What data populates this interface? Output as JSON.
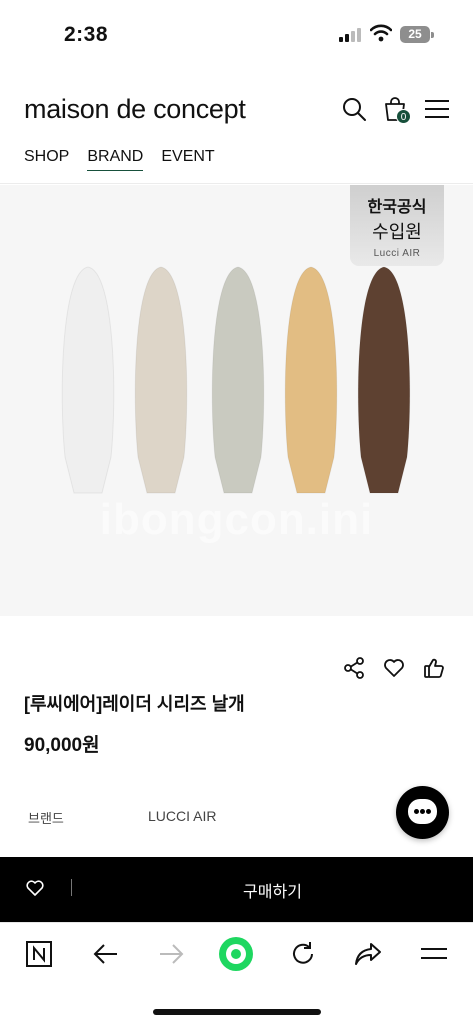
{
  "status_bar": {
    "time": "2:38",
    "battery": "25"
  },
  "header": {
    "logo": "maison de concept",
    "cart_count": "0",
    "nav": [
      {
        "label": "SHOP",
        "active": false
      },
      {
        "label": "BRAND",
        "active": true
      },
      {
        "label": "EVENT",
        "active": false
      }
    ]
  },
  "hero": {
    "badge_line1": "한국공식",
    "badge_line2": "수입원",
    "badge_brand": "Lucci AIR",
    "watermark": "ibongcon.ini",
    "blade_colors": [
      "#efefef",
      "#ddd5c8",
      "#c9cac0",
      "#e2bd83",
      "#5e4131"
    ]
  },
  "product": {
    "title": "[루씨에어]레이더 시리즈 날개",
    "price": "90,000원",
    "brand_label": "브랜드",
    "brand_value": "LUCCI AIR"
  },
  "purchase_bar": {
    "label": "구매하기"
  },
  "colors": {
    "accent": "#17503b",
    "toolbar_green": "#1ed760"
  }
}
